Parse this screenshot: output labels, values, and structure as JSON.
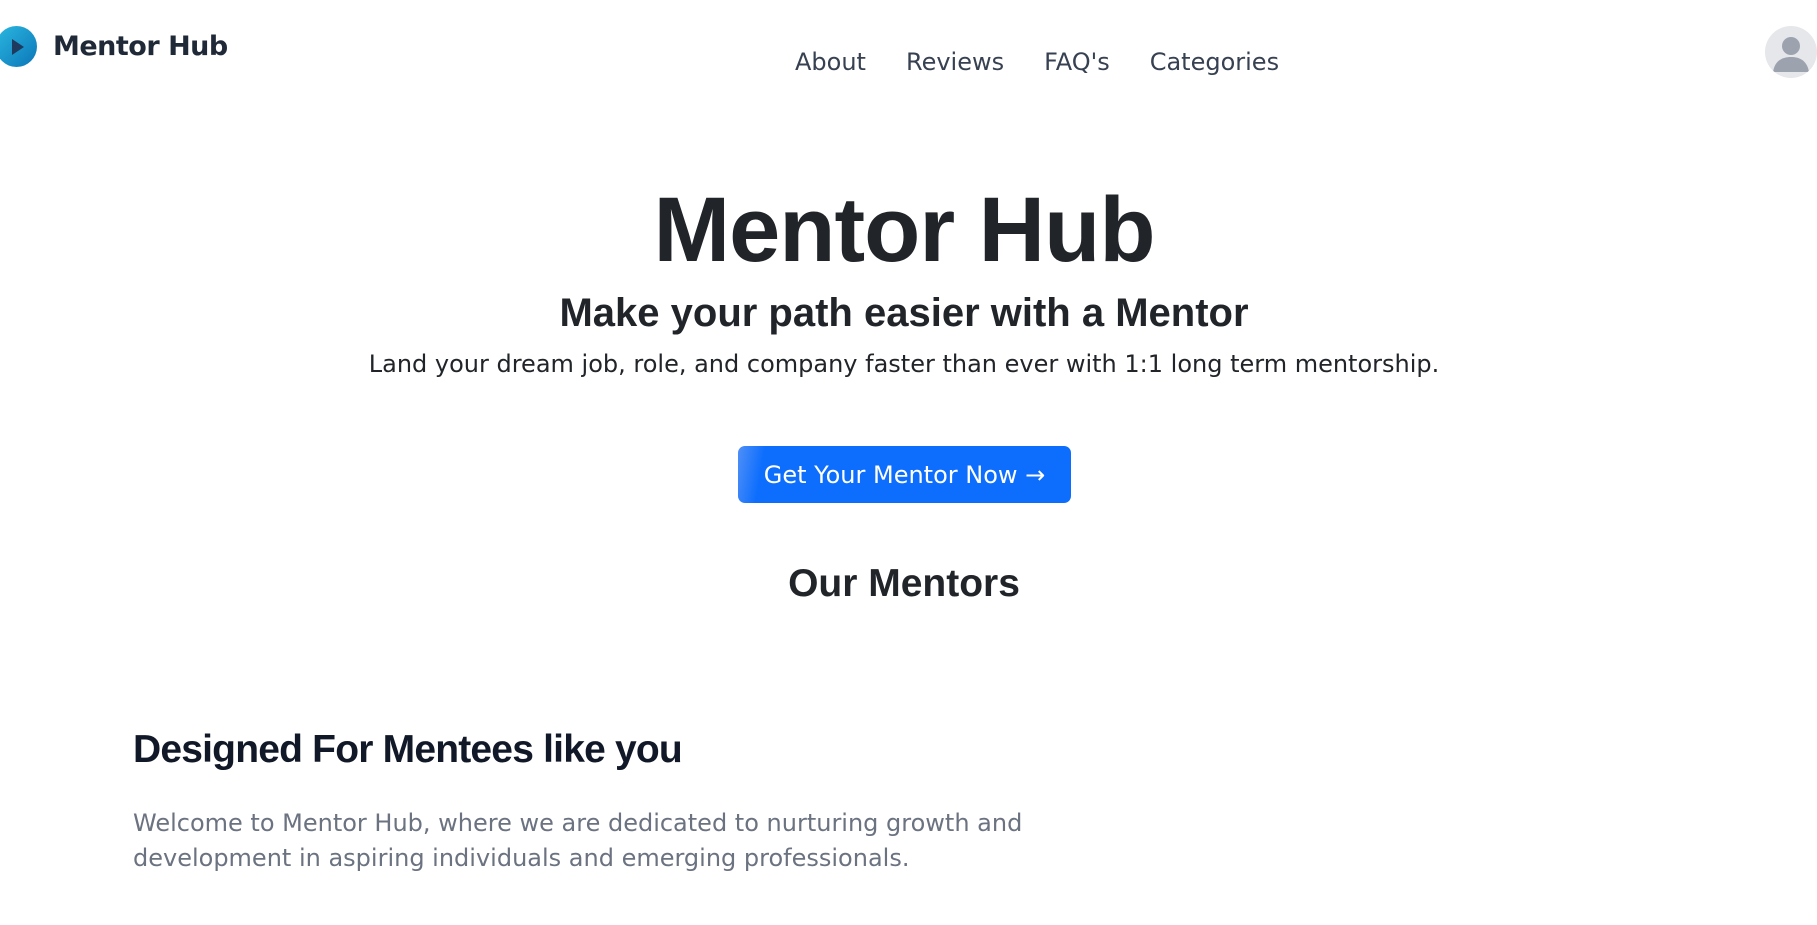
{
  "header": {
    "brand_name": "Mentor Hub",
    "logo_icon": "play-icon",
    "nav": {
      "about": "About",
      "reviews": "Reviews",
      "faqs": "FAQ's",
      "categories": "Categories"
    },
    "avatar_icon": "user-avatar-icon"
  },
  "hero": {
    "title": "Mentor Hub",
    "subtitle": "Make your path easier with a Mentor",
    "description": "Land your dream job, role, and company faster than ever with 1:1 long term mentorship.",
    "cta_label": "Get Your Mentor Now →"
  },
  "mentors_section": {
    "title": "Our Mentors"
  },
  "designed_section": {
    "title": "Designed For Mentees like you",
    "text": "Welcome to Mentor Hub, where we are dedicated to nurturing growth and development in aspiring individuals and emerging professionals."
  },
  "colors": {
    "primary": "#0d6efd",
    "logo_gradient_start": "#2bb8e0",
    "logo_gradient_end": "#0b76b8",
    "heading": "#212529",
    "muted_text": "#6b7280"
  }
}
